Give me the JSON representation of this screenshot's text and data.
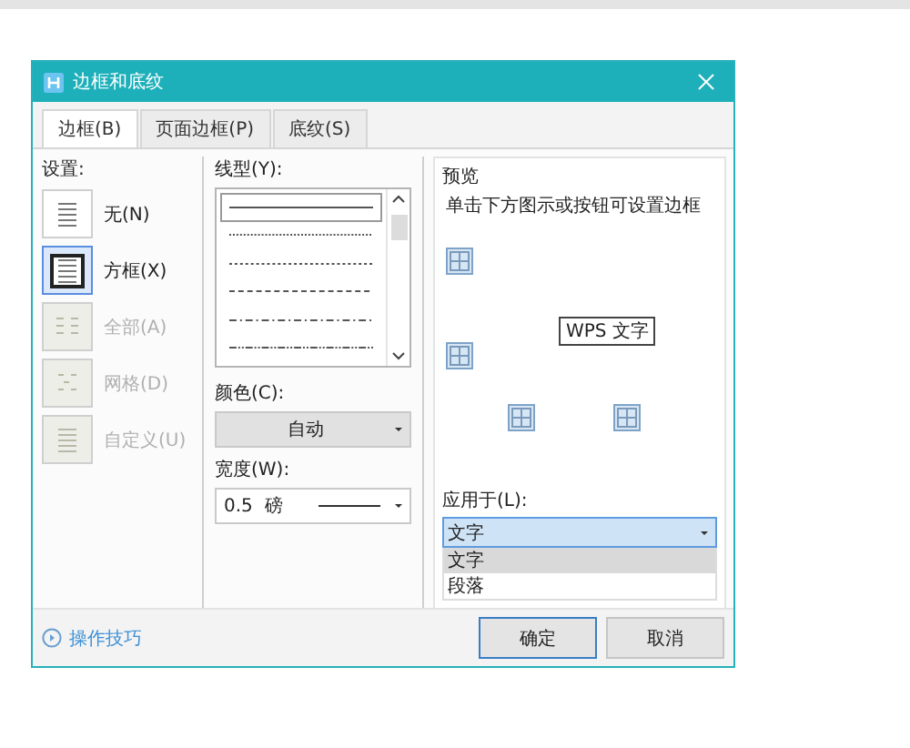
{
  "window": {
    "title": "边框和底纹"
  },
  "tabs": [
    {
      "label": "边框(B)",
      "selected": true
    },
    {
      "label": "页面边框(P)",
      "selected": false
    },
    {
      "label": "底纹(S)",
      "selected": false
    }
  ],
  "settings": {
    "label": "设置:",
    "items": [
      {
        "label": "无(N)",
        "kind": "none",
        "selected": false,
        "disabled": false
      },
      {
        "label": "方框(X)",
        "kind": "box",
        "selected": true,
        "disabled": false
      },
      {
        "label": "全部(A)",
        "kind": "all",
        "selected": false,
        "disabled": true
      },
      {
        "label": "网格(D)",
        "kind": "grid",
        "selected": false,
        "disabled": true
      },
      {
        "label": "自定义(U)",
        "kind": "custom",
        "selected": false,
        "disabled": true
      }
    ]
  },
  "line_style": {
    "label": "线型(Y):",
    "items": [
      {
        "kind": "solid",
        "selected": true
      },
      {
        "kind": "dotted",
        "selected": false
      },
      {
        "kind": "fine-dots",
        "selected": false
      },
      {
        "kind": "dashed",
        "selected": false
      },
      {
        "kind": "dash-dot",
        "selected": false
      },
      {
        "kind": "dash-dot-dot",
        "selected": false
      }
    ]
  },
  "color": {
    "label": "颜色(C):",
    "value": "自动"
  },
  "width": {
    "label": "宽度(W):",
    "value": "0.5  磅"
  },
  "preview": {
    "label": "预览",
    "hint": "单击下方图示或按钮可设置边框",
    "sample": "WPS 文字"
  },
  "apply_to": {
    "label": "应用于(L):",
    "value": "文字",
    "options": [
      {
        "label": "文字",
        "selected": true
      },
      {
        "label": "段落",
        "selected": false
      }
    ]
  },
  "tips_link": "操作技巧",
  "buttons": [
    {
      "label": "确定",
      "default": true
    },
    {
      "label": "取消",
      "default": false
    }
  ]
}
